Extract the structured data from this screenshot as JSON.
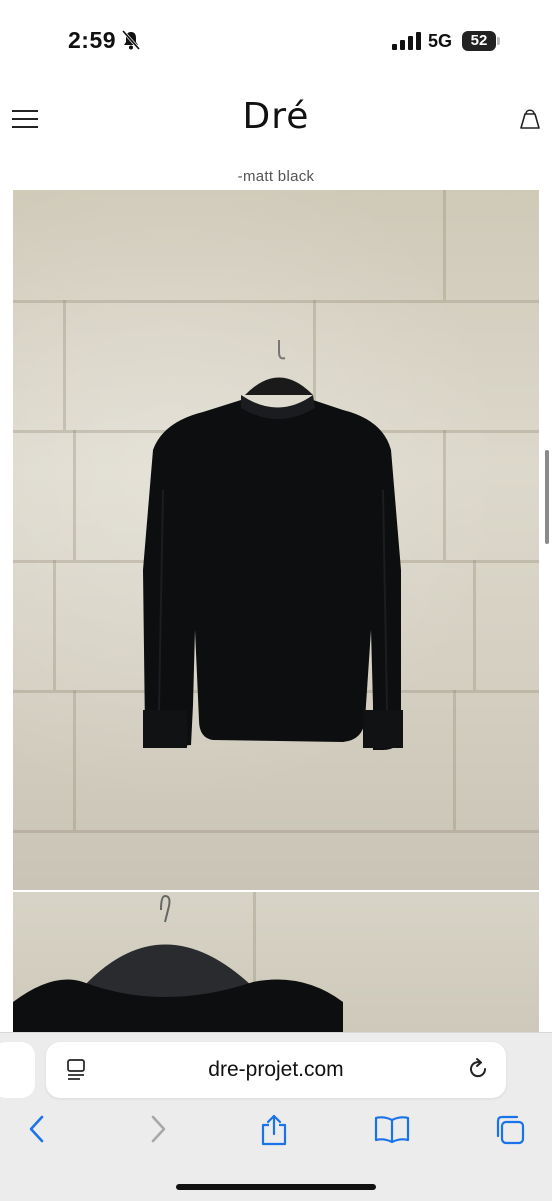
{
  "status_bar": {
    "time": "2:59",
    "network": "5G",
    "battery": "52"
  },
  "site": {
    "brand": "Dré",
    "subtitle": "-matt black"
  },
  "browser": {
    "url": "dre-projet.com"
  },
  "icons": {
    "bell": "bell-slash-icon",
    "signal": "signal-icon",
    "battery": "battery-icon",
    "menu": "hamburger-menu-icon",
    "bag": "shopping-bag-icon",
    "reader": "reader-icon",
    "reload": "reload-icon",
    "back": "back-icon",
    "forward": "forward-icon",
    "share": "share-icon",
    "bookmarks": "bookmarks-icon",
    "tabs": "tabs-icon"
  },
  "colors": {
    "accent": "#1a73e8",
    "garment": "#0d0e10",
    "wall": "#d6d1c3"
  }
}
